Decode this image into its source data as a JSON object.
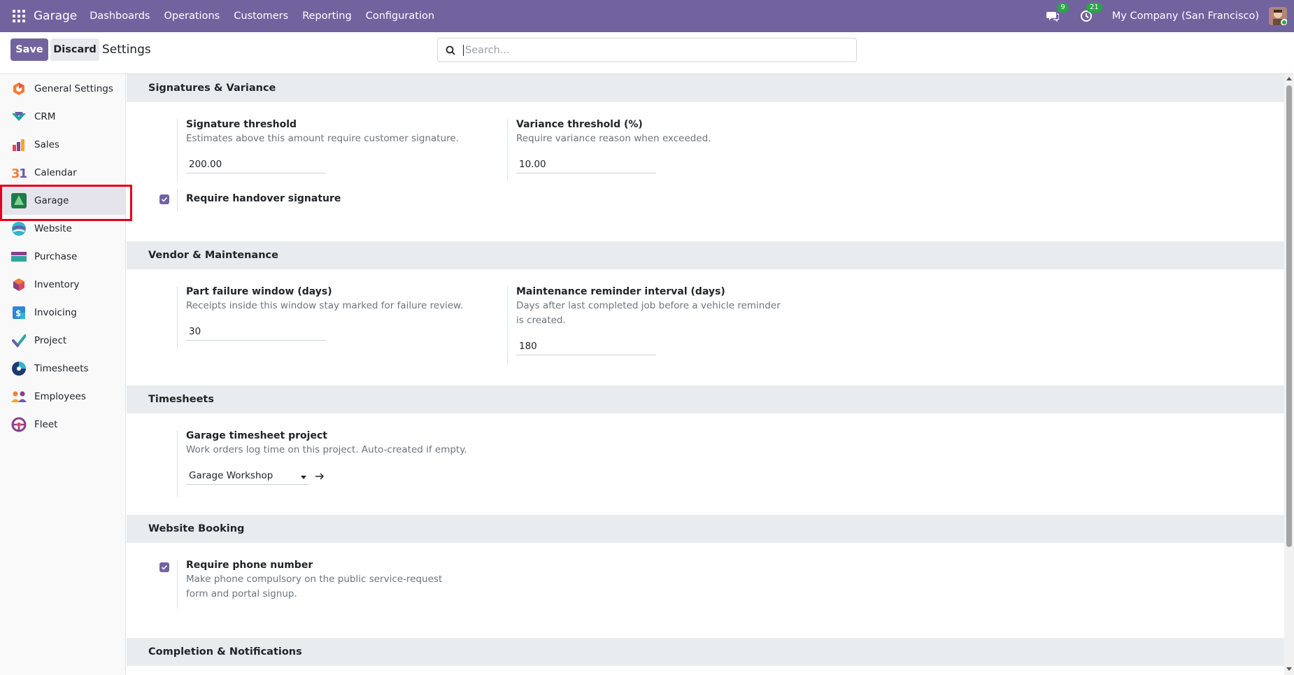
{
  "navbar": {
    "brand": "Garage",
    "menu": [
      "Dashboards",
      "Operations",
      "Customers",
      "Reporting",
      "Configuration"
    ],
    "messages_badge": "9",
    "activities_badge": "21",
    "company": "My Company (San Francisco)"
  },
  "control": {
    "save_label": "Save",
    "discard_label": "Discard",
    "title": "Settings",
    "search_placeholder": "Search..."
  },
  "sidebar": {
    "items": [
      {
        "label": "General Settings",
        "icon": "general-settings-icon"
      },
      {
        "label": "CRM",
        "icon": "crm-icon"
      },
      {
        "label": "Sales",
        "icon": "sales-icon"
      },
      {
        "label": "Calendar",
        "icon": "calendar-icon"
      },
      {
        "label": "Garage",
        "icon": "garage-icon"
      },
      {
        "label": "Website",
        "icon": "website-icon"
      },
      {
        "label": "Purchase",
        "icon": "purchase-icon"
      },
      {
        "label": "Inventory",
        "icon": "inventory-icon"
      },
      {
        "label": "Invoicing",
        "icon": "invoicing-icon"
      },
      {
        "label": "Project",
        "icon": "project-icon"
      },
      {
        "label": "Timesheets",
        "icon": "timesheets-icon"
      },
      {
        "label": "Employees",
        "icon": "employees-icon"
      },
      {
        "label": "Fleet",
        "icon": "fleet-icon"
      }
    ],
    "active": "Garage"
  },
  "sections": {
    "signatures": {
      "title": "Signatures & Variance",
      "signature_threshold": {
        "label": "Signature threshold",
        "desc": "Estimates above this amount require customer signature.",
        "value": "200.00"
      },
      "variance_threshold": {
        "label": "Variance threshold (%)",
        "desc": "Require variance reason when exceeded.",
        "value": "10.00"
      },
      "handover": {
        "label": "Require handover signature",
        "checked": true
      }
    },
    "vendor": {
      "title": "Vendor & Maintenance",
      "part_failure": {
        "label": "Part failure window (days)",
        "desc": "Receipts inside this window stay marked for failure review.",
        "value": "30"
      },
      "maintenance": {
        "label": "Maintenance reminder interval (days)",
        "desc": "Days after last completed job before a vehicle reminder is created.",
        "value": "180"
      }
    },
    "timesheets": {
      "title": "Timesheets",
      "project": {
        "label": "Garage timesheet project",
        "desc": "Work orders log time on this project. Auto-created if empty.",
        "value": "Garage Workshop"
      }
    },
    "website": {
      "title": "Website Booking",
      "phone": {
        "label": "Require phone number",
        "desc": "Make phone compulsory on the public service-request form and portal signup.",
        "checked": true
      }
    },
    "completion": {
      "title": "Completion & Notifications"
    }
  },
  "colors": {
    "brand": "#71639e",
    "highlight": "#e3001b",
    "badge": "#28a745"
  }
}
